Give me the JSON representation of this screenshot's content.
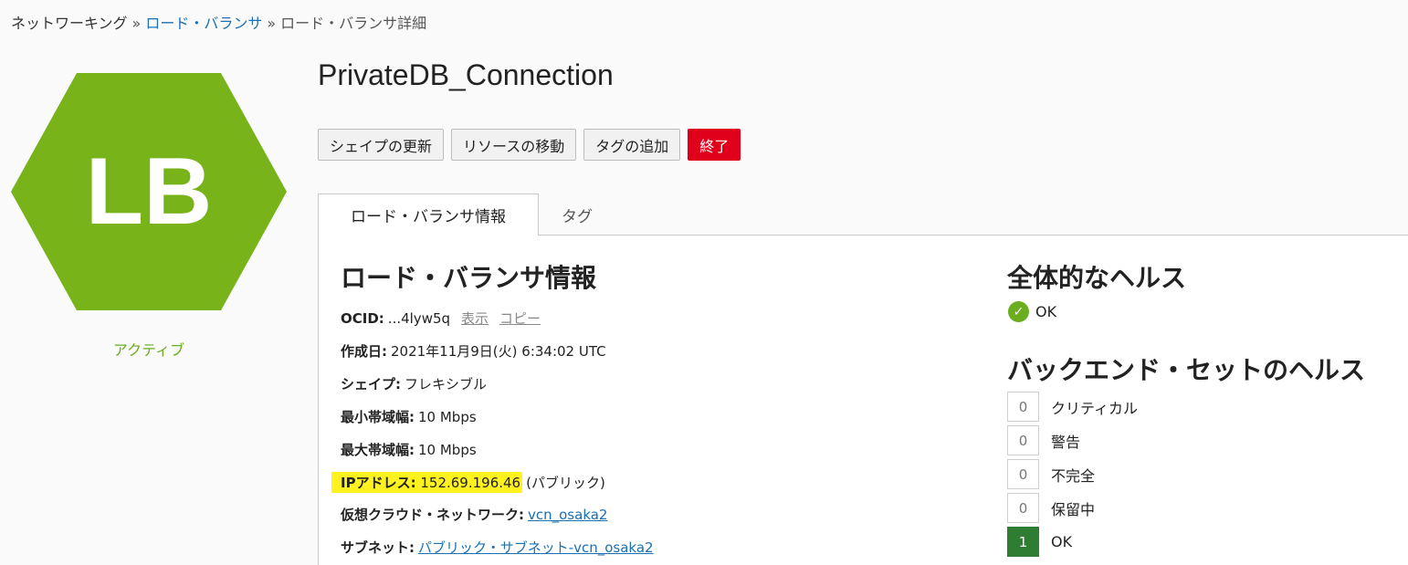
{
  "breadcrumb": {
    "root": "ネットワーキング",
    "sep": "»",
    "parent": "ロード・バランサ",
    "current": "ロード・バランサ詳細"
  },
  "resource": {
    "icon_text": "LB",
    "status": "アクティブ",
    "title": "PrivateDB_Connection"
  },
  "actions": {
    "update_shape": "シェイプの更新",
    "move_resource": "リソースの移動",
    "add_tags": "タグの追加",
    "terminate": "終了"
  },
  "tabs": {
    "info": "ロード・バランサ情報",
    "tags": "タグ"
  },
  "info": {
    "heading": "ロード・バランサ情報",
    "ocid_label": "OCID:",
    "ocid_value": "...4lyw5q",
    "show_link": "表示",
    "copy_link": "コピー",
    "created_label": "作成日:",
    "created_value": "2021年11月9日(火) 6:34:02 UTC",
    "shape_label": "シェイプ:",
    "shape_value": "フレキシブル",
    "min_bw_label": "最小帯域幅:",
    "min_bw_value": "10 Mbps",
    "max_bw_label": "最大帯域幅:",
    "max_bw_value": "10 Mbps",
    "ip_label": "IPアドレス:",
    "ip_value": "152.69.196.46",
    "ip_type": "(パブリック)",
    "vcn_label": "仮想クラウド・ネットワーク:",
    "vcn_value": "vcn_osaka2",
    "subnet_label": "サブネット:",
    "subnet_value": "パブリック・サブネット-vcn_osaka2"
  },
  "overall_health": {
    "heading": "全体的なヘルス",
    "status": "OK"
  },
  "backend_health": {
    "heading": "バックエンド・セットのヘルス",
    "rows": [
      {
        "count": "0",
        "label": "クリティカル"
      },
      {
        "count": "0",
        "label": "警告"
      },
      {
        "count": "0",
        "label": "不完全"
      },
      {
        "count": "0",
        "label": "保留中"
      },
      {
        "count": "1",
        "label": "OK"
      }
    ]
  },
  "colors": {
    "hexagon": "#78b31a",
    "danger": "#e0001b",
    "link": "#1a6fb5",
    "ok_badge": "#2e7d32",
    "highlight": "#fff21f"
  }
}
